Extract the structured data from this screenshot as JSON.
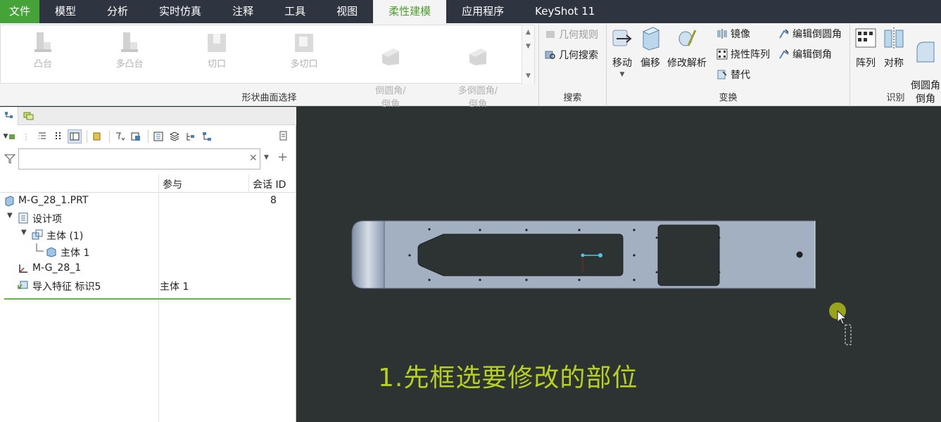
{
  "menu": {
    "tabs": [
      "文件",
      "模型",
      "分析",
      "实时仿真",
      "注释",
      "工具",
      "视图",
      "柔性建模",
      "应用程序",
      "KeyShot 11"
    ],
    "active_index": 7
  },
  "ribbon": {
    "shape_group": {
      "label": "形状曲面选择",
      "items": [
        "凸台",
        "多凸台",
        "切口",
        "多切口",
        "倒圆角/\n倒角",
        "多倒圆角/\n倒角"
      ]
    },
    "search_group": {
      "label": "搜索",
      "geometry_rule": "几何规则",
      "geometry_search": "几何搜索"
    },
    "transform_group": {
      "label": "变换",
      "move": "移动",
      "offset": "偏移",
      "modify_analytic": "修改解析",
      "mirror": "镜像",
      "flexible_pattern": "挠性阵列",
      "substitute": "替代",
      "edit_round": "编辑倒圆角",
      "edit_chamfer": "编辑倒角"
    },
    "recognize_group": {
      "label": "识别",
      "pattern": "阵列",
      "symmetry": "对称",
      "round_chamfer": "倒圆角\n倒角"
    }
  },
  "tree": {
    "filter": {
      "value": "",
      "placeholder": ""
    },
    "columns": {
      "participate": "参与",
      "session_id": "会话 ID"
    },
    "rows": [
      {
        "name": "M-G_28_1.PRT",
        "participate": "",
        "id": "8"
      },
      {
        "name": "设计项",
        "participate": "",
        "id": ""
      },
      {
        "name": "主体 (1)",
        "participate": "",
        "id": ""
      },
      {
        "name": "主体 1",
        "participate": "",
        "id": ""
      },
      {
        "name": "M-G_28_1",
        "participate": "",
        "id": ""
      },
      {
        "name": "导入特征 标识5",
        "participate": "主体 1",
        "id": ""
      }
    ]
  },
  "viewport": {
    "caption": "1.先框选要修改的部位"
  },
  "colors": {
    "menubar": "#2f3540",
    "file_tab": "#46a33a",
    "active_tab_text": "#4f9e2e",
    "viewport_bg": "#2d3233",
    "part_fill": "#a3b0c2",
    "caption": "#b6d11c",
    "cursor_dot": "#9aa31c"
  },
  "icons": [
    "filter-icon",
    "close-icon",
    "plus-icon",
    "part-icon",
    "design-items-icon",
    "body-icon",
    "csys-icon",
    "import-feature-icon",
    "cursor-icon"
  ]
}
